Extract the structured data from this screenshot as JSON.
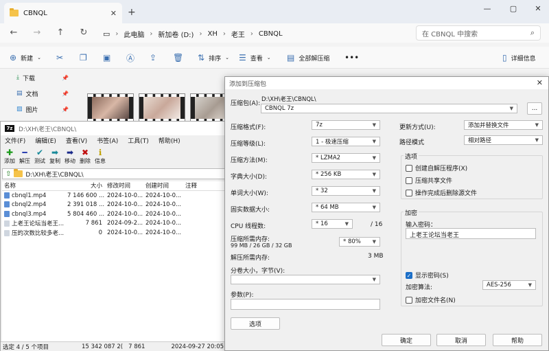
{
  "explorer": {
    "tab_title": "CBNQL",
    "crumbs": [
      "此电脑",
      "新加卷 (D:)",
      "XH",
      "老王",
      "CBNQL"
    ],
    "search_placeholder": "在 CBNQL 中搜索",
    "cmd": {
      "new": "新建",
      "sort": "排序",
      "view": "查看",
      "extract_all": "全部解压缩",
      "details": "详细信息"
    },
    "sidebar": [
      {
        "label": "下载",
        "icon": "download-icon"
      },
      {
        "label": "文档",
        "icon": "document-icon"
      },
      {
        "label": "图片",
        "icon": "picture-icon"
      }
    ]
  },
  "sevenzip": {
    "title": "D:\\XH\\老王\\CBNQL\\",
    "menu": [
      "文件(F)",
      "编辑(E)",
      "查看(V)",
      "书签(A)",
      "工具(T)",
      "帮助(H)"
    ],
    "tools": [
      {
        "label": "添加",
        "glyph": "✚",
        "color": "#1a9a1a"
      },
      {
        "label": "解压",
        "glyph": "━",
        "color": "#2a3fb0"
      },
      {
        "label": "测试",
        "glyph": "✔",
        "color": "#1a8a9a"
      },
      {
        "label": "复制",
        "glyph": "➡",
        "color": "#1a8a9a"
      },
      {
        "label": "移动",
        "glyph": "➡",
        "color": "#1a2a8a"
      },
      {
        "label": "删除",
        "glyph": "✖",
        "color": "#c01010"
      },
      {
        "label": "信息",
        "glyph": "ℹ",
        "color": "#c0a000"
      }
    ],
    "path": "D:\\XH\\老王\\CBNQL\\",
    "headers": [
      "名称",
      "大小",
      "修改时间",
      "创建时间",
      "注释"
    ],
    "rows": [
      [
        "cbnql1.mp4",
        "7 146 600 ...",
        "2024-10-0...",
        "2024-10-0...",
        ""
      ],
      [
        "cbnql2.mp4",
        "2 391 018 ...",
        "2024-10-0...",
        "2024-10-0...",
        ""
      ],
      [
        "cbnql3.mp4",
        "5 804 460 ...",
        "2024-10-0...",
        "2024-10-0...",
        ""
      ],
      [
        "上老王论坛当老王...",
        "7 861",
        "2024-09-2...",
        "2024-10-0...",
        ""
      ],
      [
        "压的次数比较多老...",
        "0",
        "2024-10-0...",
        "2024-10-0...",
        ""
      ]
    ],
    "status": [
      "选定 4 / 5 个项目",
      "15 342 087 2(",
      "7 861",
      "2024-09-27 20:05:54"
    ]
  },
  "dialog": {
    "title": "添加到压缩包",
    "archive_label": "压缩包(A):",
    "archive_dir": "D:\\XH\\老王\\CBNQL\\",
    "archive_name": "CBNQL 7z",
    "browse": "...",
    "format_label": "压缩格式(F):",
    "format": "7z",
    "level_label": "压缩等级(L):",
    "level": "1 - 极速压缩",
    "method_label": "压缩方法(M):",
    "method": "* LZMA2",
    "dict_label": "字典大小(D):",
    "dict": "* 256 KB",
    "word_label": "单词大小(W):",
    "word": "* 32",
    "solid_label": "固实数据大小:",
    "solid": "* 64 MB",
    "threads_label": "CPU 线程数:",
    "threads": "* 16",
    "threads_total": "/ 16",
    "mem_label": "压缩所需内存:",
    "mem_detail": "99 MB / 26 GB / 32 GB",
    "mem_pct": "* 80%",
    "demem_label": "解压所需内存:",
    "demem": "3 MB",
    "split_label": "分卷大小，字节(V):",
    "params_label": "参数(P):",
    "options_btn": "选项",
    "update_label": "更新方式(U):",
    "update": "添加并替换文件",
    "pathmode_label": "路径模式",
    "pathmode": "相对路径",
    "options_group": "选项",
    "opt_sfx": "创建自解压程序(X)",
    "opt_shared": "压缩共享文件",
    "opt_delete": "操作完成后删除源文件",
    "enc_group": "加密",
    "pwd_label": "输入密码：",
    "pwd": "上老王论坛当老王",
    "show_pwd": "显示密码(S)",
    "enc_method_label": "加密算法:",
    "enc_method": "AES-256",
    "enc_names": "加密文件名(N)",
    "ok": "确定",
    "cancel": "取消",
    "help": "帮助"
  }
}
